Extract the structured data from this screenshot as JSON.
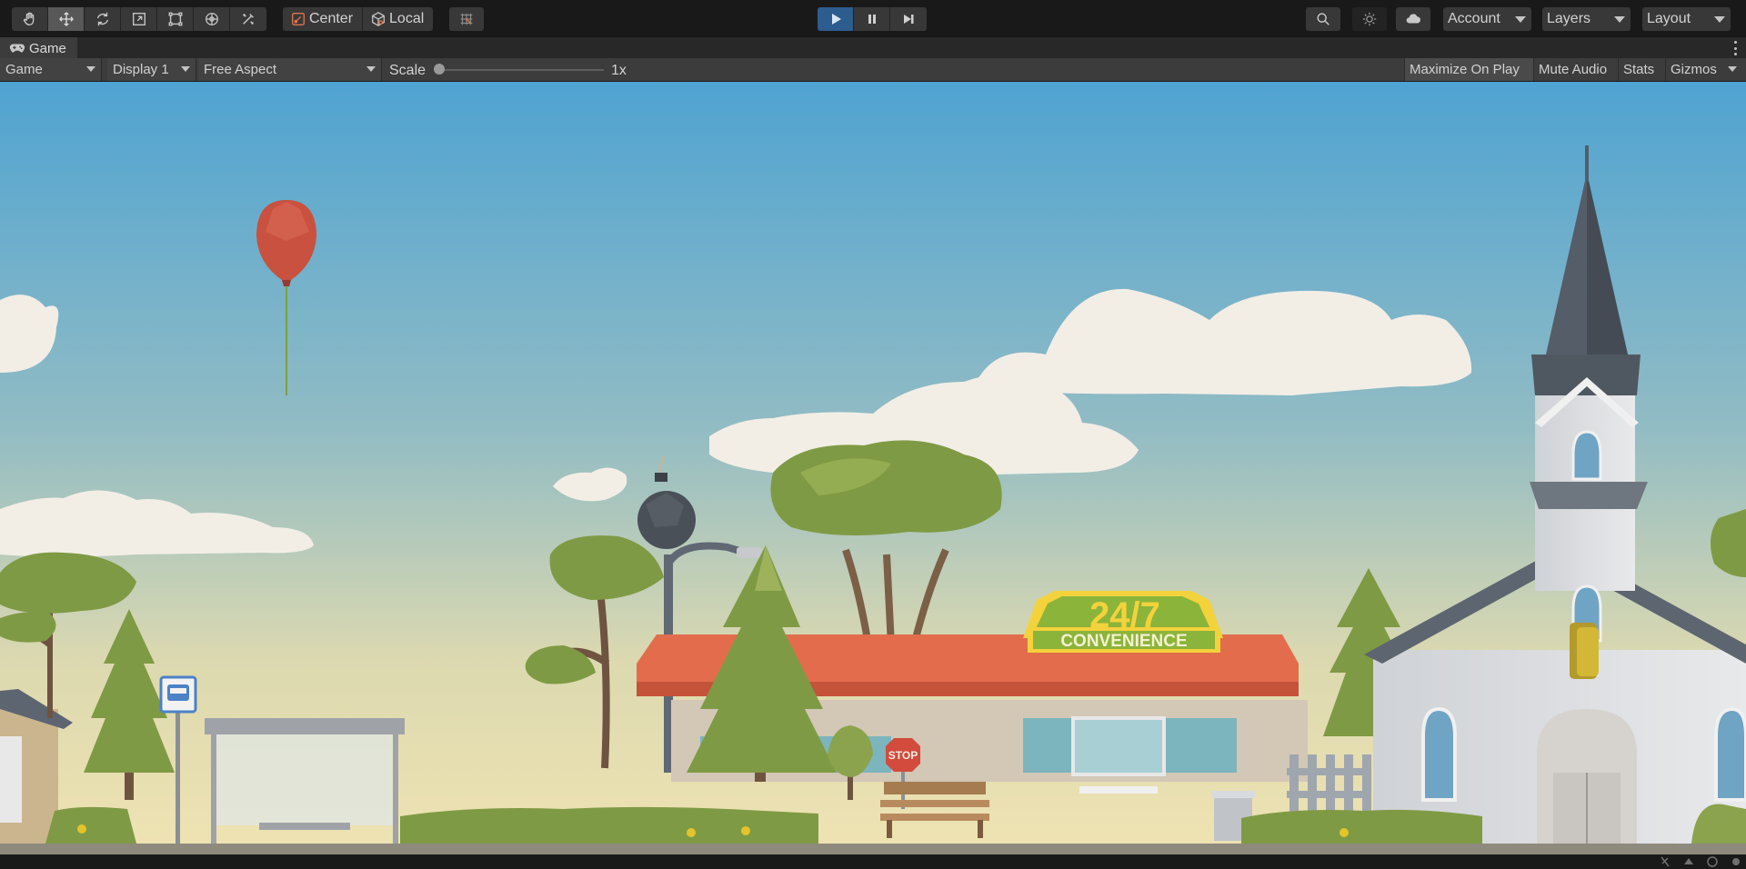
{
  "toolbar": {
    "tools": [
      {
        "name": "hand-tool",
        "icon": "hand-icon"
      },
      {
        "name": "move-tool",
        "icon": "move-icon",
        "active": true
      },
      {
        "name": "rotate-tool",
        "icon": "rotate-icon"
      },
      {
        "name": "scale-tool",
        "icon": "scale-icon"
      },
      {
        "name": "rect-tool",
        "icon": "rect-transform-icon"
      },
      {
        "name": "transform-tool",
        "icon": "transform-icon"
      },
      {
        "name": "custom-tool",
        "icon": "tools-icon"
      }
    ],
    "pivot_label": "Center",
    "space_label": "Local",
    "grid_snap_icon": "grid-snap-icon",
    "play_icons": [
      "play-icon",
      "pause-icon",
      "step-icon"
    ],
    "search_icon": "search-icon",
    "lighting_icon": "sun-icon",
    "cloud_icon": "cloud-icon",
    "account_label": "Account",
    "layers_label": "Layers",
    "layout_label": "Layout"
  },
  "tab": {
    "label": "Game",
    "icon": "game-controller-icon"
  },
  "game_options": {
    "view_mode": "Game",
    "display": "Display 1",
    "aspect": "Free Aspect",
    "scale_label": "Scale",
    "scale_value": "1x",
    "scale_fraction": 0.0,
    "maximize_on_play": "Maximize On Play",
    "mute_audio": "Mute Audio",
    "stats": "Stats",
    "gizmos": "Gizmos"
  },
  "scene": {
    "store_sign_top": "24/7",
    "store_sign_bottom": "CONVENIENCE",
    "stop_sign": "STOP",
    "colors": {
      "sky_top": "#4fa3d2",
      "sky_bottom": "#efe3b2",
      "balloon": "#c8513f",
      "roof": "#e26c4c",
      "foliage": "#7f9a44"
    }
  },
  "colors": {
    "accent_play": "#2d5c8f",
    "toolbar_bg": "#191919",
    "button_bg": "#383838"
  }
}
